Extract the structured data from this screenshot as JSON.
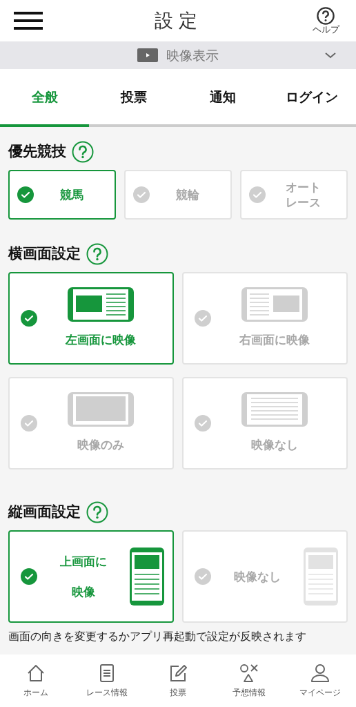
{
  "header": {
    "title": "設 定",
    "help_label": "ヘルプ"
  },
  "video_bar": {
    "label": "映像表示"
  },
  "tabs": [
    {
      "label": "全般",
      "selected": true
    },
    {
      "label": "投票",
      "selected": false
    },
    {
      "label": "通知",
      "selected": false
    },
    {
      "label": "ログイン",
      "selected": false
    }
  ],
  "sections": [
    {
      "title": "優先競技",
      "kind": "chips",
      "options": [
        {
          "label": "競馬",
          "selected": true
        },
        {
          "label": "競輪",
          "selected": false
        },
        {
          "label_lines": [
            "オート",
            "レース"
          ],
          "selected": false
        }
      ]
    },
    {
      "title": "横画面設定",
      "kind": "landscape",
      "options": [
        {
          "label": "左画面に映像",
          "kind": "left",
          "selected": true
        },
        {
          "label": "右画面に映像",
          "kind": "right",
          "selected": false
        },
        {
          "label": "映像のみ",
          "kind": "only",
          "selected": false
        },
        {
          "label": "映像なし",
          "kind": "none",
          "selected": false
        }
      ]
    },
    {
      "title": "縦画面設定",
      "kind": "portrait",
      "options": [
        {
          "label_lines": [
            "上画面に",
            "映像"
          ],
          "kind": "top",
          "selected": true
        },
        {
          "label": "映像なし",
          "kind": "none",
          "selected": false
        }
      ]
    }
  ],
  "note": "画面の向きを変更するかアプリ再起動で設定が反映されます",
  "nav": [
    {
      "label": "ホーム"
    },
    {
      "label": "レース情報"
    },
    {
      "label": "投票"
    },
    {
      "label": "予想情報"
    },
    {
      "label": "マイページ"
    }
  ]
}
